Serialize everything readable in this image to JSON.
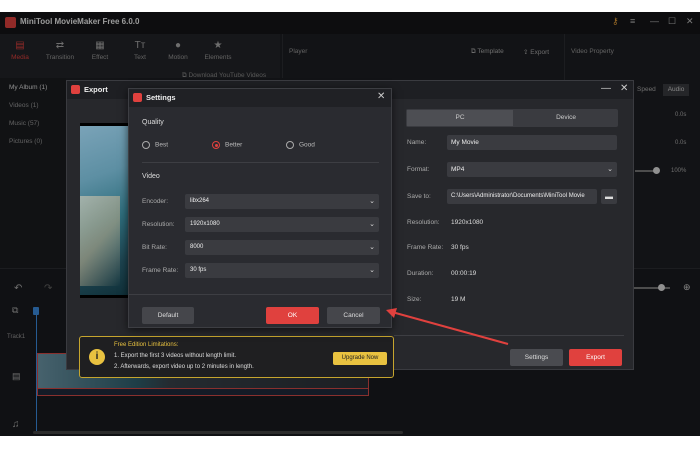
{
  "app": {
    "title": "MiniTool MovieMaker Free 6.0.0"
  },
  "toolbar": {
    "items": [
      {
        "label": "Media",
        "icon": "media-icon"
      },
      {
        "label": "Transition",
        "icon": "transition-icon"
      },
      {
        "label": "Effect",
        "icon": "effect-icon"
      },
      {
        "label": "Text",
        "icon": "text-icon"
      },
      {
        "label": "Motion",
        "icon": "motion-icon"
      },
      {
        "label": "Elements",
        "icon": "elements-icon"
      }
    ]
  },
  "albums": [
    {
      "label": "My Album (1)"
    },
    {
      "label": "Videos (1)"
    },
    {
      "label": "Music (57)"
    },
    {
      "label": "Pictures (0)"
    }
  ],
  "download_link": "Download YouTube Videos",
  "player": {
    "label": "Player",
    "template": "Template",
    "export": "Export"
  },
  "video_property": {
    "label": "Video Property",
    "speed": "Speed",
    "audio": "Audio",
    "val1": "0.0s",
    "val2": "0.0s",
    "val3": "100%"
  },
  "timeline": {
    "track": "Track1"
  },
  "export": {
    "title": "Export",
    "tabs": [
      "PC",
      "Device"
    ],
    "name_label": "Name:",
    "name_value": "My Movie",
    "format_label": "Format:",
    "format_value": "MP4",
    "save_label": "Save to:",
    "save_value": "C:\\Users\\Administrator\\Documents\\MiniTool Movie",
    "resolution_label": "Resolution:",
    "resolution_value": "1920x1080",
    "framerate_label": "Frame Rate:",
    "framerate_value": "30 fps",
    "duration_label": "Duration:",
    "duration_value": "00:00:19",
    "size_label": "Size:",
    "size_value": "19 M",
    "settings_btn": "Settings",
    "export_btn": "Export"
  },
  "limits": {
    "title": "Free Edition Limitations:",
    "line1": "1. Export the first 3 videos without length limit.",
    "line2": "2. Afterwards, export video up to 2 minutes in length.",
    "upgrade": "Upgrade Now"
  },
  "settings": {
    "title": "Settings",
    "quality_label": "Quality",
    "quality_options": [
      "Best",
      "Better",
      "Good"
    ],
    "quality_selected": "Better",
    "video_label": "Video",
    "encoder_label": "Encoder:",
    "encoder_value": "libx264",
    "resolution_label": "Resolution:",
    "resolution_value": "1920x1080",
    "bitrate_label": "Bit Rate:",
    "bitrate_value": "8000",
    "framerate_label": "Frame Rate:",
    "framerate_value": "30 fps",
    "default_btn": "Default",
    "ok_btn": "OK",
    "cancel_btn": "Cancel"
  },
  "colors": {
    "accent": "#e0413e",
    "warning": "#e9c240",
    "arrow": "#e0413e"
  }
}
